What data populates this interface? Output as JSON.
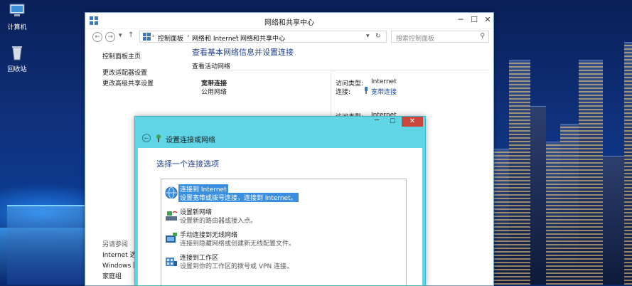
{
  "desktop": {
    "icons": [
      {
        "label": "计算机",
        "icon": "computer-icon"
      },
      {
        "label": "回收站",
        "icon": "recycle-bin-icon"
      }
    ]
  },
  "window": {
    "title": "网络和共享中心",
    "nav": {
      "back": "←",
      "forward": "→",
      "recent": "▾",
      "up": "↑",
      "refresh": "↻"
    },
    "breadcrumb": [
      "控制面板",
      "网络和 Internet",
      "网络和共享中心"
    ],
    "search_placeholder": "搜索控制面板",
    "sidebar": {
      "home": "控制面板主页",
      "links": [
        "更改适配器设置",
        "更改高级共享设置"
      ],
      "see_also_heading": "另请参阅",
      "see_also": [
        "Internet 选项",
        "Windows 防",
        "家庭组"
      ]
    },
    "main": {
      "heading": "查看基本网络信息并设置连接",
      "active_networks_label": "查看活动网络",
      "network_name": "宽带连接",
      "network_type": "公用网络",
      "access_type_label": "访问类型:",
      "access_type_value": "Internet",
      "connections_label": "连接:",
      "connections_value": "宽带连接",
      "access_type_label_2": "访问类型:",
      "access_type_value_2": "Internet"
    },
    "caption_buttons": {
      "minimize": "─",
      "maximize": "☐",
      "close": "✕"
    }
  },
  "dialog": {
    "title": "设置连接或网络",
    "prompt": "选择一个连接选项",
    "options": [
      {
        "title": "连接到 Internet",
        "desc": "设置宽带或拨号连接，连接到 Internet。",
        "icon": "globe-icon",
        "selected": true
      },
      {
        "title": "设置新网络",
        "desc": "设置新的路由器或接入点。",
        "icon": "router-icon",
        "selected": false
      },
      {
        "title": "手动连接到无线网络",
        "desc": "连接到隐藏网络或创建新无线配置文件。",
        "icon": "wireless-icon",
        "selected": false
      },
      {
        "title": "连接到工作区",
        "desc": "设置到你的工作区的拨号或 VPN 连接。",
        "icon": "workplace-icon",
        "selected": false
      }
    ],
    "caption_buttons": {
      "minimize": "─",
      "maximize": "☐",
      "close": "✕"
    }
  }
}
